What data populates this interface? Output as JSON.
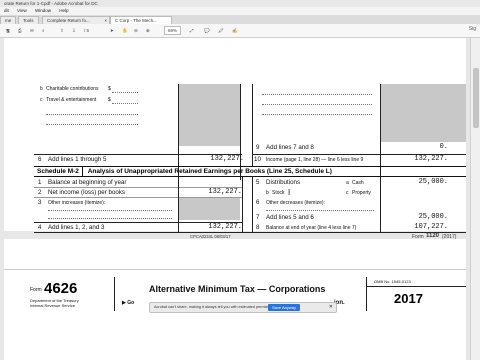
{
  "window": {
    "title": "orate Return for 1-Cpdf - Adobe Acrobat for DC"
  },
  "menu": [
    "dit",
    "View",
    "Window",
    "Help"
  ],
  "tabs": {
    "home": "me",
    "tools": "Tools",
    "tab1": "Complete Return fo...",
    "tab2": "C Corp - The Mech...",
    "close": "×"
  },
  "toolbar": {
    "page_total": "/ 5",
    "zoom": "69%",
    "sign_in": "Sig"
  },
  "m1": {
    "line_b": "Charitable contributions",
    "line_b_prefix": "b",
    "line_b_amount_prefix": "$",
    "line_c": "Travel & entertainment",
    "line_c_prefix": "c",
    "line_c_amount_prefix": "$",
    "line6_num": "6",
    "line6": "Add lines 1 through 5",
    "line6_val": "132,227.",
    "line9_num": "9",
    "line9": "Add lines 7 and 8",
    "line9_val": "0.",
    "line10_num": "10",
    "line10": "Income (page 1, line 28) — line 6 less line 9",
    "line10_val": "132,227."
  },
  "m2": {
    "tag": "Schedule M-2",
    "title": "Analysis of Unappropriated Retained Earnings per Books (Line 25, Schedule L)",
    "l1_num": "1",
    "l1": "Balance at beginning of year",
    "l2_num": "2",
    "l2": "Net income (loss) per books",
    "l2_val": "132,227.",
    "l3_num": "3",
    "l3": "Other increases (itemize):",
    "l4_num": "4",
    "l4": "Add lines 1, 2, and 3",
    "l4_val": "132,227.",
    "l5_num": "5",
    "l5": "Distributions",
    "l5a": "a",
    "l5a_label": "Cash",
    "l5a_val": "25,000.",
    "l5b": "b",
    "l5b_label": "Stock",
    "l5b_cursor": "I",
    "l5c": "c",
    "l5c_label": "Property",
    "l6_num": "6",
    "l6": "Other decreases (itemize):",
    "l7_num": "7",
    "l7": "Add lines 5 and 6",
    "l7_val": "25,000.",
    "l8_num": "8",
    "l8": "Balance at end of year (line 4 less line 7)",
    "l8_val": "107,227."
  },
  "page_footer": {
    "code": "CPCA0234L  08/03/17",
    "form_prefix": "Form",
    "form": "1120",
    "year": "(2017)"
  },
  "form4626": {
    "form_label": "Form",
    "number": "4626",
    "dept1": "Department of the Treasury",
    "dept2": "Internal Revenue Service",
    "title": "Alternative Minimum Tax — Corporations",
    "go_prefix": "▶ Go",
    "tail": "ion.",
    "omb": "OMB No. 1545-0123",
    "year": "2017"
  },
  "banner": {
    "text": "Acrobat can't share, making it always tell you with estimated permissions.",
    "button": "Save Anyway",
    "close": "✕"
  }
}
